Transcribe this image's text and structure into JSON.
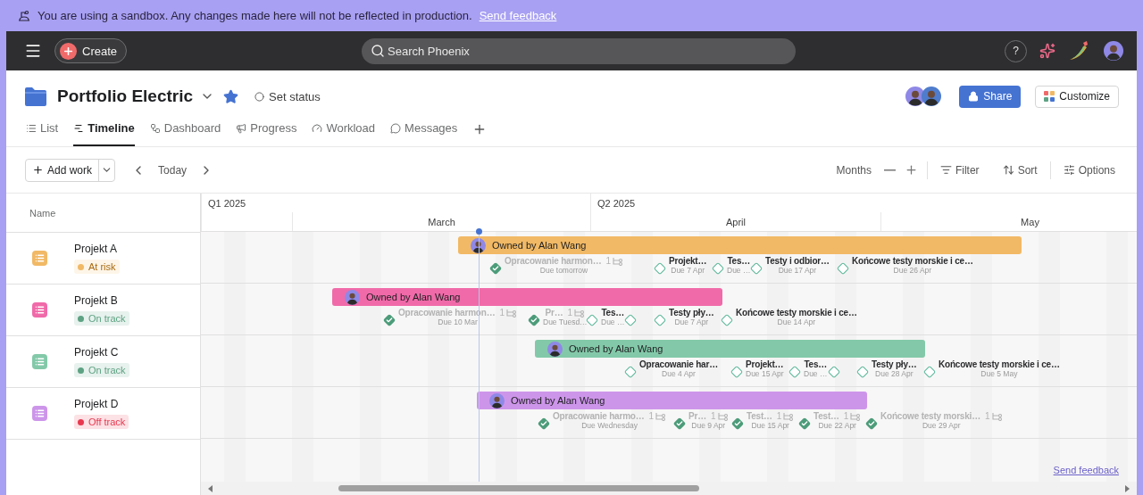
{
  "banner": {
    "text": "You are using a sandbox. Any changes made here will not be reflected in production.",
    "link": "Send feedback"
  },
  "topbar": {
    "create": "Create",
    "search": {
      "placeholder": "Search Phoenix"
    },
    "help": "?"
  },
  "header": {
    "title": "Portfolio Electric",
    "starred": true,
    "status": "Set status",
    "share": "Share",
    "customize": "Customize"
  },
  "tabs": [
    {
      "label": "List",
      "selected": false
    },
    {
      "label": "Timeline",
      "selected": true
    },
    {
      "label": "Dashboard",
      "selected": false
    },
    {
      "label": "Progress",
      "selected": false
    },
    {
      "label": "Workload",
      "selected": false
    },
    {
      "label": "Messages",
      "selected": false
    }
  ],
  "toolbar": {
    "add_work": "Add work",
    "today": "Today",
    "zoom": "Months",
    "filter": "Filter",
    "sort": "Sort",
    "options": "Options"
  },
  "timeline": {
    "name_header": "Name",
    "quarters": [
      "Q1 2025",
      "Q2 2025"
    ],
    "months": [
      "March",
      "April",
      "May"
    ],
    "projects": [
      {
        "name": "Projekt A",
        "color": "#f1b965",
        "status": {
          "label": "At risk",
          "color": "#f1b965"
        },
        "bar": "Owned by Alan Wang",
        "milestones": [
          {
            "title": "Opracowanie harmon…",
            "due": "Due tomorrow",
            "done": true,
            "subtasks": "1"
          },
          {
            "title": "Projekt…",
            "due": "Due 7 Apr",
            "done": false
          },
          {
            "title": "Tes…",
            "due": "Due …",
            "done": false
          },
          {
            "title": "Testy i odbior…",
            "due": "Due 17 Apr",
            "done": false
          },
          {
            "title": "Końcowe testy morskie i ce…",
            "due": "Due 26 Apr",
            "done": false
          }
        ]
      },
      {
        "name": "Projekt B",
        "color": "#f06aa9",
        "status": {
          "label": "On track",
          "color": "#5da283"
        },
        "bar": "Owned by Alan Wang",
        "milestones": [
          {
            "title": "Opracowanie harmon…",
            "due": "Due 10 Mar",
            "done": true,
            "subtasks": "1"
          },
          {
            "title": "Pr…",
            "due": "Due Tuesd…",
            "done": true,
            "subtasks": "1"
          },
          {
            "title": "Tes…",
            "due": "Due …",
            "done": false
          },
          {
            "done": false
          },
          {
            "title": "Testy pły…",
            "due": "Due 7 Apr",
            "done": false
          },
          {
            "title": "Końcowe testy morskie i ce…",
            "due": "Due 14 Apr",
            "done": false
          }
        ]
      },
      {
        "name": "Projekt C",
        "color": "#83c9a9",
        "status": {
          "label": "On track",
          "color": "#5da283"
        },
        "bar": "Owned by Alan Wang",
        "milestones": [
          {
            "title": "Opracowanie har…",
            "due": "Due 4 Apr",
            "done": false
          },
          {
            "title": "Projekt…",
            "due": "Due 15 Apr",
            "done": false
          },
          {
            "title": "Tes…",
            "due": "Due …",
            "done": false
          },
          {
            "done": false
          },
          {
            "title": "Testy pły…",
            "due": "Due 28 Apr",
            "done": false
          },
          {
            "title": "Końcowe testy morskie i ce…",
            "due": "Due 5 May",
            "done": false
          }
        ]
      },
      {
        "name": "Projekt D",
        "color": "#cd95ea",
        "status": {
          "label": "Off track",
          "color": "#e8384f"
        },
        "bar": "Owned by Alan Wang",
        "milestones": [
          {
            "title": "Opracowanie harmo…",
            "due": "Due Wednesday",
            "done": true,
            "subtasks": "1"
          },
          {
            "title": "Pr…",
            "due": "Due 9 Apr",
            "done": true,
            "subtasks": "1"
          },
          {
            "title": "Test…",
            "due": "Due 15 Apr",
            "done": true,
            "subtasks": "1"
          },
          {
            "title": "Test…",
            "due": "Due 22 Apr",
            "done": true,
            "subtasks": "1"
          },
          {
            "title": "Końcowe testy morski…",
            "due": "Due 29 Apr",
            "done": true,
            "subtasks": "1"
          }
        ]
      }
    ],
    "feedback": "Send feedback"
  }
}
